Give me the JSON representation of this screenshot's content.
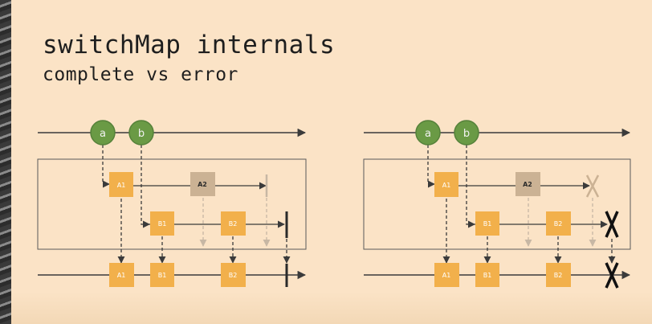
{
  "slide": {
    "title": "switchMap internals",
    "subtitle": "complete vs error"
  },
  "diagram": {
    "colors": {
      "marble": "#6a9a45",
      "marble_stroke": "#55813a",
      "inner_box": "#f2b04b",
      "cancelled_box": "#cbb294",
      "line": "#3b3b3b",
      "faded": "#c7b7a4"
    },
    "outer_marbles": [
      "a",
      "b"
    ],
    "inner_a": {
      "label": "A1",
      "cancelled_label": "A2"
    },
    "inner_b": {
      "labels": [
        "B1",
        "B2"
      ]
    },
    "output": {
      "labels": [
        "A1",
        "B1",
        "B2"
      ]
    },
    "panels": [
      {
        "id": "complete",
        "termination": "complete"
      },
      {
        "id": "error",
        "termination": "error"
      }
    ]
  }
}
